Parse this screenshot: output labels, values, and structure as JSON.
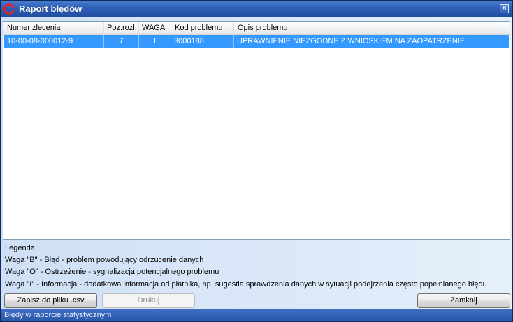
{
  "window": {
    "title": "Raport błędów",
    "close_glyph": "×",
    "app_icon": "app-logo-icon"
  },
  "table": {
    "columns": [
      "Numer zlecenia",
      "Poz.rozl.",
      "WAGA",
      "Kod problemu",
      "Opis problemu"
    ],
    "rows": [
      {
        "numer": "10-00-08-000012-9",
        "poz": "7",
        "waga": "I",
        "kod": "3000188",
        "opis": "UPRAWNIENIE NIEZGODNE Z WNIOSKIEM NA ZAOPATRZENIE",
        "selected": true
      }
    ],
    "selection_color": "#3399ff"
  },
  "legend": {
    "title": "Legenda :",
    "lines": [
      "Waga \"B\" - Błąd - problem powodujący odrzucenie danych",
      "Waga \"O\" - Ostrzeżenie - sygnalizacja potencjalnego problemu",
      "Waga \"I\" - Informacja - dodatkowa informacja od płatnika, np. sugestia sprawdzenia danych w sytuacji podejrzenia często popełnianego błędu"
    ]
  },
  "buttons": {
    "save_csv": "Zapisz do pliku .csv",
    "print": "Drukuj",
    "close": "Zamknij"
  },
  "status": {
    "text": "Błędy w raporcie statystycznym"
  }
}
